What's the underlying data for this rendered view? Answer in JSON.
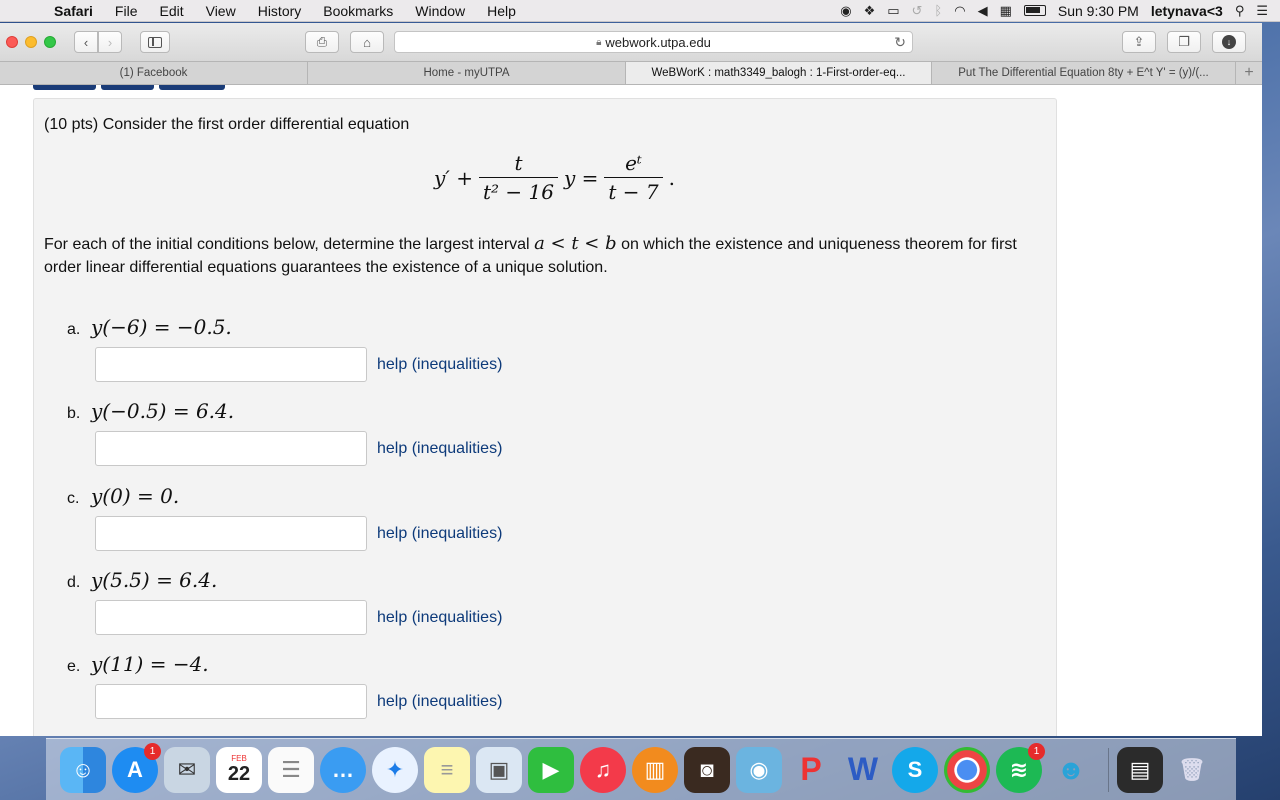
{
  "menubar": {
    "app": "Safari",
    "items": [
      "File",
      "Edit",
      "View",
      "History",
      "Bookmarks",
      "Window",
      "Help"
    ],
    "clock": "Sun 9:30 PM",
    "user": "letynava<3"
  },
  "browser": {
    "url": "webwork.utpa.edu",
    "tabs": [
      "(1) Facebook",
      "Home - myUTPA",
      "WeBWorK : math3349_balogh : 1-First-order-eq...",
      "Put The Differential Equation 8ty + E^t Y' = (y)/(..."
    ],
    "new_tab_label": "+"
  },
  "problem": {
    "intro": "(10 pts) Consider the first order differential equation",
    "equation": {
      "lhs_prefix": "y′ +",
      "frac1_num": "t",
      "frac1_den": "t² − 16",
      "mid": "y =",
      "frac2_num": "eᵗ",
      "frac2_den": "t − 7",
      "end": "."
    },
    "instructions_1": "For each of the initial conditions below, determine the largest interval",
    "interval": "a < t < b",
    "instructions_2": "on which the existence and uniqueness theorem for first order linear differential equations guarantees the existence of a unique solution.",
    "parts": [
      {
        "letter": "a.",
        "condition": "y(−6) = −0.5.",
        "value": "",
        "help": "help (inequalities)"
      },
      {
        "letter": "b.",
        "condition": "y(−0.5) = 6.4.",
        "value": "",
        "help": "help (inequalities)"
      },
      {
        "letter": "c.",
        "condition": "y(0) = 0.",
        "value": "",
        "help": "help (inequalities)"
      },
      {
        "letter": "d.",
        "condition": "y(5.5) = 6.4.",
        "value": "",
        "help": "help (inequalities)"
      },
      {
        "letter": "e.",
        "condition": "y(11) = −4.",
        "value": "",
        "help": "help (inequalities)"
      }
    ]
  },
  "dock": {
    "calendar_month": "FEB",
    "calendar_day": "22",
    "app_store_badge": "1",
    "spotify_badge": "1"
  }
}
